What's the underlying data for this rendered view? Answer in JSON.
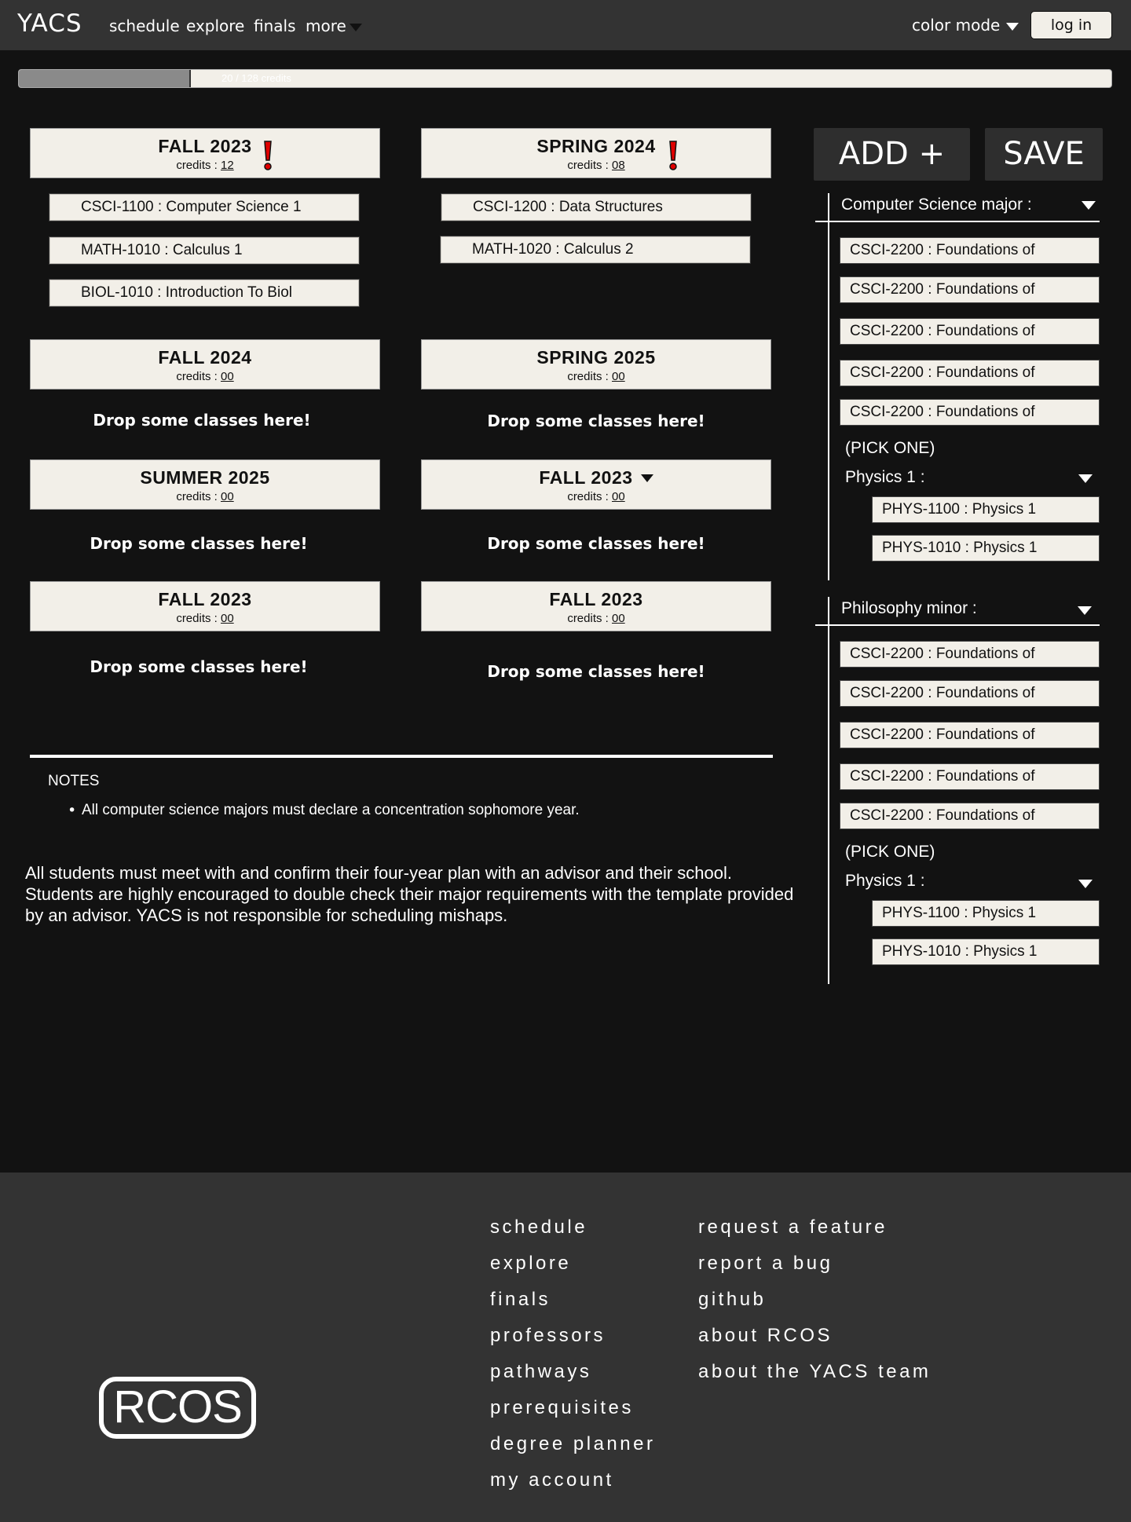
{
  "nav": {
    "logo": "YACS",
    "links": [
      "schedule",
      "explore",
      "finals",
      "more"
    ],
    "color_mode": "color mode",
    "login": "log in"
  },
  "progress": {
    "label": "20 / 128 credits",
    "earned": 20,
    "total": 128
  },
  "semesters": [
    {
      "name": "FALL 2023",
      "credits_label": "credits : ",
      "credits": "12",
      "warning": true,
      "courses": [
        "CSCI-1100 : Computer Science 1",
        "MATH-1010 : Calculus 1",
        "BIOL-1010 : Introduction To Biol"
      ]
    },
    {
      "name": "SPRING 2024",
      "credits_label": "credits : ",
      "credits": "08",
      "warning": true,
      "courses": [
        "CSCI-1200 : Data Structures",
        "MATH-1020 : Calculus 2"
      ]
    },
    {
      "name": "FALL 2024",
      "credits_label": "credits : ",
      "credits": "00",
      "drop": "Drop some classes here!"
    },
    {
      "name": "SPRING 2025",
      "credits_label": "credits : ",
      "credits": "00",
      "drop": "Drop some classes here!"
    },
    {
      "name": "SUMMER 2025",
      "credits_label": "credits : ",
      "credits": "00",
      "drop": "Drop some classes here!"
    },
    {
      "name": "FALL 2023",
      "credits_label": "credits : ",
      "credits": "00",
      "drop": "Drop some classes here!",
      "dropdown": true
    },
    {
      "name": "FALL 2023",
      "credits_label": "credits : ",
      "credits": "00",
      "drop": "Drop some classes here!"
    },
    {
      "name": "FALL 2023",
      "credits_label": "credits : ",
      "credits": "00",
      "drop": "Drop some classes here!"
    }
  ],
  "buttons": {
    "add": "ADD +",
    "save": "SAVE"
  },
  "requirements": [
    {
      "title": "Computer Science major :",
      "items": [
        "CSCI-2200 : Foundations of",
        "CSCI-2200 : Foundations of",
        "CSCI-2200 : Foundations of",
        "CSCI-2200 : Foundations of",
        "CSCI-2200 : Foundations of"
      ],
      "pick_label": "(PICK ONE)",
      "group_title": "Physics 1 :",
      "options": [
        "PHYS-1100 : Physics 1",
        "PHYS-1010 : Physics 1"
      ]
    },
    {
      "title": "Philosophy minor :",
      "items": [
        "CSCI-2200 : Foundations of",
        "CSCI-2200 : Foundations of",
        "CSCI-2200 : Foundations of",
        "CSCI-2200 : Foundations of",
        "CSCI-2200 : Foundations of"
      ],
      "pick_label": "(PICK ONE)",
      "group_title": "Physics 1 :",
      "options": [
        "PHYS-1100 : Physics 1",
        "PHYS-1010 : Physics 1"
      ]
    }
  ],
  "notes": {
    "title": "NOTES",
    "items": [
      "All computer science majors must declare a concentration sophomore year."
    ]
  },
  "disclaimer": "All students must meet with and confirm their four-year plan with an advisor and their school. Students are highly encouraged to double check their major requirements with the template provided by an advisor. YACS is not responsible for scheduling mishaps.",
  "footer": {
    "col1": [
      "schedule",
      "explore",
      "finals",
      "professors",
      "pathways",
      "prerequisites",
      "degree planner",
      "my account"
    ],
    "col2": [
      "request a feature",
      "report a bug",
      "github",
      "about RCOS",
      "about the YACS team"
    ],
    "logo": "RCOS"
  },
  "colors": {
    "nav": "#333333",
    "page": "#121212",
    "card": "#f2efe8",
    "warning": "#e00000"
  }
}
